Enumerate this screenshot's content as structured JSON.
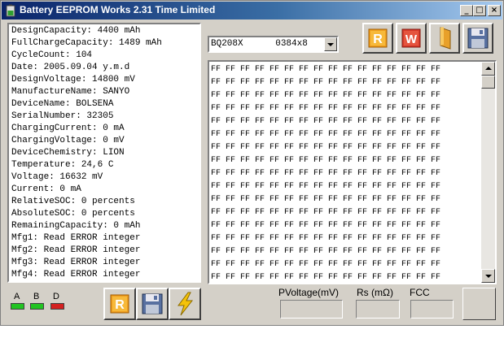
{
  "window": {
    "title": "Battery EEPROM Works  2.31 Time Limited",
    "controls": {
      "minimize": "_",
      "maximize": "□",
      "close": "×"
    }
  },
  "info": {
    "lines": [
      "DesignCapacity: 4400 mAh",
      "FullChargeCapacity: 1489 mAh",
      "CycleCount: 104",
      "Date: 2005.09.04 y.m.d",
      "DesignVoltage: 14800 mV",
      "ManufactureName: SANYO",
      "DeviceName: BOLSENA",
      "SerialNumber: 32305",
      "ChargingCurrent: 0 mA",
      "ChargingVoltage: 0 mV",
      "DeviceChemistry: LION",
      "Temperature: 24,6 C",
      "Voltage: 16632 mV",
      "Current: 0 mA",
      "RelativeSOC: 0 percents",
      "AbsoluteSOC: 0 percents",
      "RemainingCapacity: 0 mAh",
      "Mfg1: Read ERROR integer",
      "Mfg2: Read ERROR integer",
      "Mfg3: Read ERROR integer",
      "Mfg4: Read ERROR integer"
    ]
  },
  "chip_select": {
    "value": "BQ208X      0384x8"
  },
  "toolbar": {
    "read_icon": "read-r-icon",
    "write_icon": "write-w-icon",
    "open_icon": "folder-icon",
    "save_icon": "floppy-save-icon",
    "read_letter": "R",
    "write_letter": "W"
  },
  "hex": {
    "rows": [
      "FF FF FF FF FF FF FF FF FF FF FF FF FF FF FF FF",
      "FF FF FF FF FF FF FF FF FF FF FF FF FF FF FF FF",
      "FF FF FF FF FF FF FF FF FF FF FF FF FF FF FF FF",
      "FF FF FF FF FF FF FF FF FF FF FF FF FF FF FF FF",
      "FF FF FF FF FF FF FF FF FF FF FF FF FF FF FF FF",
      "FF FF FF FF FF FF FF FF FF FF FF FF FF FF FF FF",
      "FF FF FF FF FF FF FF FF FF FF FF FF FF FF FF FF",
      "FF FF FF FF FF FF FF FF FF FF FF FF FF FF FF FF",
      "FF FF FF FF FF FF FF FF FF FF FF FF FF FF FF FF",
      "FF FF FF FF FF FF FF FF FF FF FF FF FF FF FF FF",
      "FF FF FF FF FF FF FF FF FF FF FF FF FF FF FF FF",
      "FF FF FF FF FF FF FF FF FF FF FF FF FF FF FF FF",
      "FF FF FF FF FF FF FF FF FF FF FF FF FF FF FF FF",
      "FF FF FF FF FF FF FF FF FF FF FF FF FF FF FF FF",
      "FF FF FF FF FF FF FF FF FF FF FF FF FF FF FF FF",
      "FF FF FF FF FF FF FF FF FF FF FF FF FF FF FF FF",
      "FF FF FF FF FF FF FF FF FF FF FF FF FF FF FF FF"
    ]
  },
  "leds": [
    {
      "label": "A",
      "color": "#22c422"
    },
    {
      "label": "B",
      "color": "#22c422"
    },
    {
      "label": "D",
      "color": "#d42020"
    }
  ],
  "bottom_toolbar": {
    "read_letter": "R",
    "read_icon": "read-r-icon",
    "save_icon": "floppy-save-icon",
    "flash_icon": "lightning-icon"
  },
  "fields": {
    "pvoltage_label": "PVoltage(mV)",
    "rs_label": "Rs (mΩ)",
    "fcc_label": "FCC",
    "pvoltage_value": "",
    "rs_value": "",
    "fcc_value": ""
  },
  "colors": {
    "read_orange": "#f0a020",
    "write_red": "#d83a2a",
    "face": "#d4d0c8",
    "title_start": "#0a246a",
    "title_end": "#a6caf0"
  }
}
